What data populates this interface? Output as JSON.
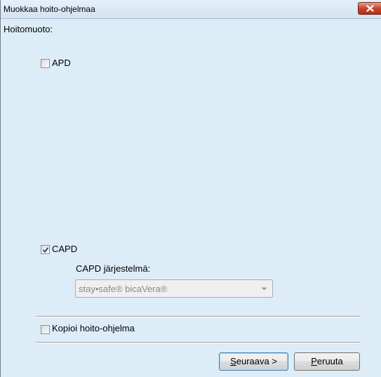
{
  "window": {
    "title": "Muokkaa hoito-ohjelmaa",
    "close_icon": "close-icon"
  },
  "form": {
    "hoitomuoto_label": "Hoitomuoto:",
    "apd": {
      "label": "APD",
      "checked": false
    },
    "capd": {
      "label": "CAPD",
      "checked": true
    },
    "capd_system_label": "CAPD järjestelmä:",
    "capd_system_value": "stay•safe® bicaVera®",
    "copy_program": {
      "label": "Kopioi hoito-ohjelma",
      "checked": false
    }
  },
  "buttons": {
    "next_mnemonic": "S",
    "next_rest": "euraava >",
    "cancel_mnemonic": "P",
    "cancel_rest": "eruuta"
  },
  "colors": {
    "background": "#dcedf8",
    "close_button": "#c7442b"
  }
}
